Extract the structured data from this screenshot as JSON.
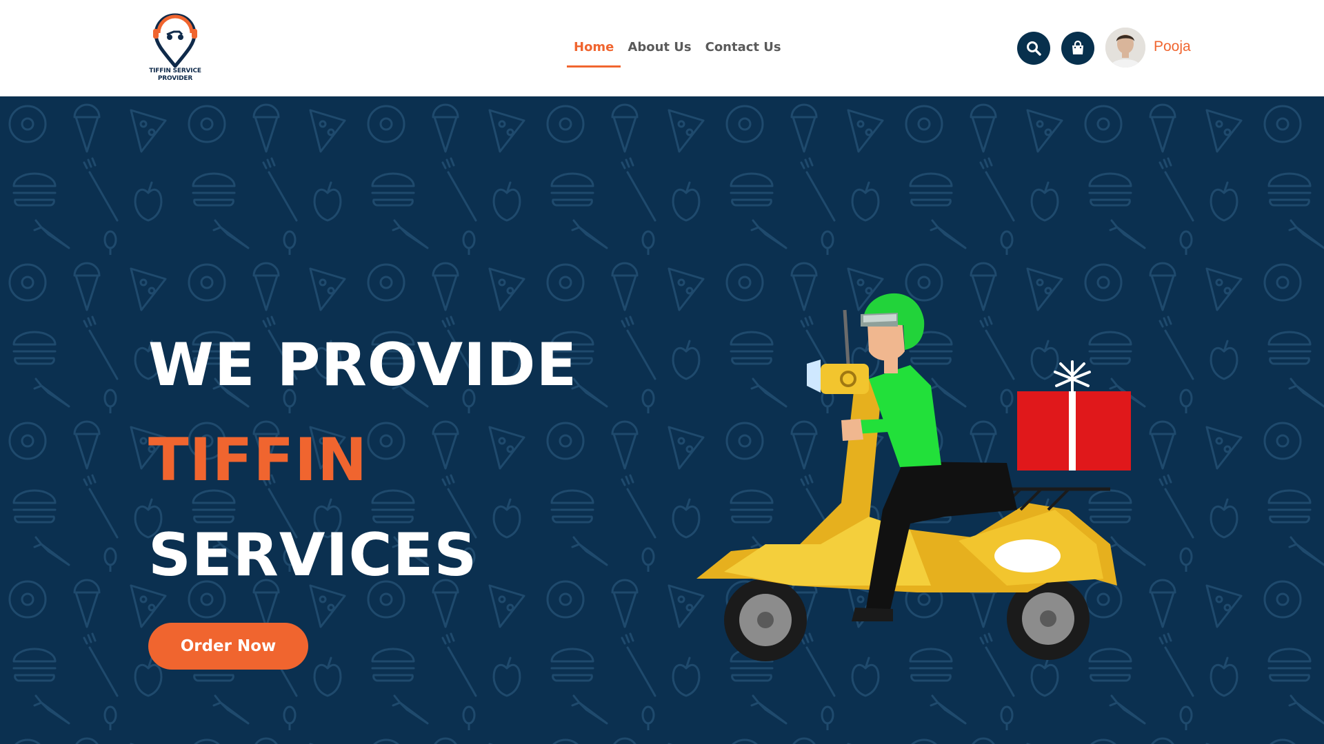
{
  "brand": {
    "logo_text_line1": "TIFFIN SERVICE",
    "logo_text_line2": "PROVIDER"
  },
  "nav": {
    "items": [
      {
        "label": "Home",
        "active": true
      },
      {
        "label": "About Us",
        "active": false
      },
      {
        "label": "Contact Us",
        "active": false
      }
    ]
  },
  "header_icons": {
    "search": "search-icon",
    "cart": "shopping-bag-icon"
  },
  "user": {
    "name": "Pooja"
  },
  "hero": {
    "line1": "WE PROVIDE",
    "line2": "TIFFIN",
    "line3": "SERVICES",
    "cta_label": "Order Now"
  },
  "colors": {
    "accent": "#f0652f",
    "navy": "#0b3050",
    "icon_button": "#07304d"
  }
}
